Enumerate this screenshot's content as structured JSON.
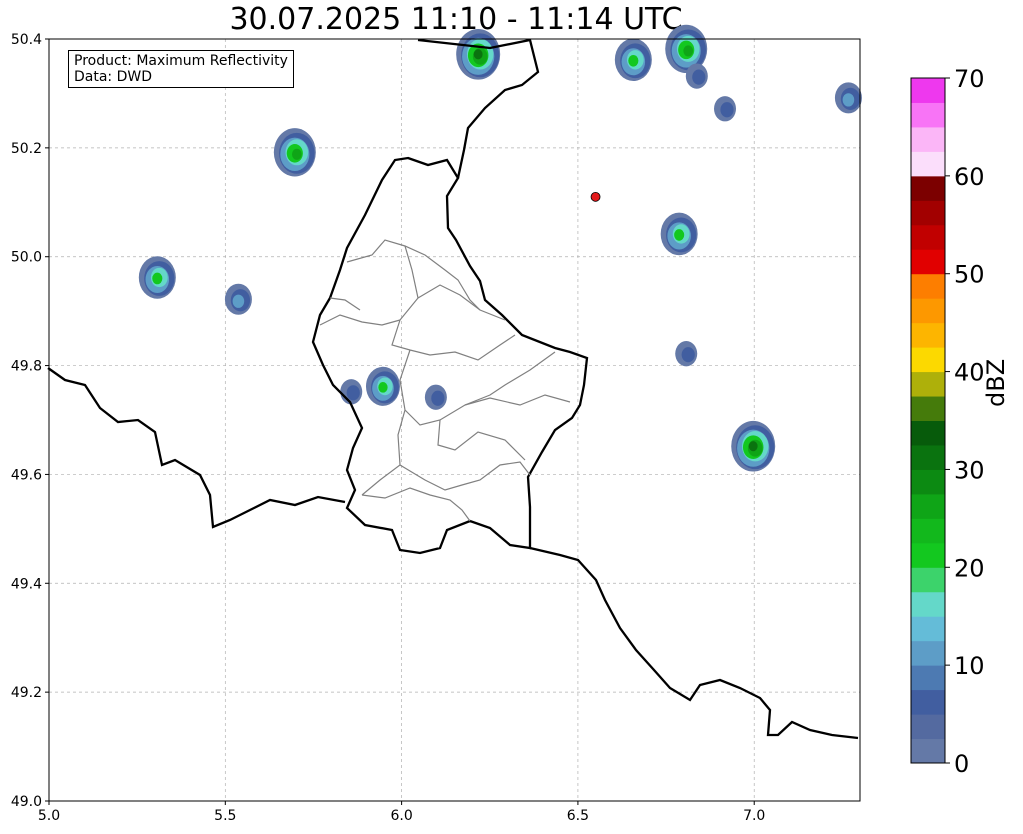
{
  "title": "30.07.2025 11:10 - 11:14 UTC",
  "info_box": {
    "product": "Product: Maximum Reflectivity",
    "data": "Data: DWD"
  },
  "map_data": {
    "type": "radar-map",
    "lon_range": [
      5.0,
      7.3
    ],
    "lat_range": [
      49.0,
      50.4
    ],
    "x_ticks": [
      "5.0",
      "5.5",
      "6.0",
      "6.5",
      "7.0"
    ],
    "y_ticks": [
      "49.0",
      "49.2",
      "49.4",
      "49.6",
      "49.8",
      "50.0",
      "50.2",
      "50.4"
    ],
    "grid": "dashed",
    "marker": {
      "lon": 6.55,
      "lat": 50.11,
      "color": "#e31a1c"
    },
    "echoes": [
      {
        "lon": 6.22,
        "lat": 50.37,
        "max_dbz": 32
      },
      {
        "lon": 6.66,
        "lat": 50.36,
        "max_dbz": 25
      },
      {
        "lon": 6.81,
        "lat": 50.38,
        "max_dbz": 30
      },
      {
        "lon": 5.7,
        "lat": 50.19,
        "max_dbz": 30
      },
      {
        "lon": 5.31,
        "lat": 49.96,
        "max_dbz": 25
      },
      {
        "lon": 5.54,
        "lat": 49.92,
        "max_dbz": 15
      },
      {
        "lon": 6.79,
        "lat": 50.04,
        "max_dbz": 25
      },
      {
        "lon": 5.95,
        "lat": 49.76,
        "max_dbz": 22
      },
      {
        "lon": 5.86,
        "lat": 49.75,
        "max_dbz": 10
      },
      {
        "lon": 6.1,
        "lat": 49.74,
        "max_dbz": 10
      },
      {
        "lon": 6.81,
        "lat": 49.82,
        "max_dbz": 10
      },
      {
        "lon": 7.0,
        "lat": 49.65,
        "max_dbz": 32
      },
      {
        "lon": 7.27,
        "lat": 50.29,
        "max_dbz": 15
      },
      {
        "lon": 6.92,
        "lat": 50.27,
        "max_dbz": 10
      },
      {
        "lon": 6.84,
        "lat": 50.33,
        "max_dbz": 10
      }
    ]
  },
  "colorbar": {
    "label": "dBZ",
    "ticks": [
      "0",
      "10",
      "20",
      "30",
      "40",
      "50",
      "60",
      "70"
    ],
    "min": 0,
    "max": 70,
    "step": 2.5,
    "colors": [
      "#6479a7",
      "#546aa0",
      "#415ea0",
      "#4d7ab2",
      "#5d9dc7",
      "#64bcd8",
      "#64d8c9",
      "#3cd36b",
      "#13c81f",
      "#12b81c",
      "#0fa517",
      "#0c8a12",
      "#0a730f",
      "#075b0b",
      "#457b0b",
      "#aeb00a",
      "#fcd900",
      "#fdb500",
      "#fd9800",
      "#fd7e00",
      "#e10000",
      "#c10000",
      "#a20000",
      "#7c0000",
      "#fbdefb",
      "#fbb6f7",
      "#f874f6",
      "#ee38ee"
    ]
  }
}
